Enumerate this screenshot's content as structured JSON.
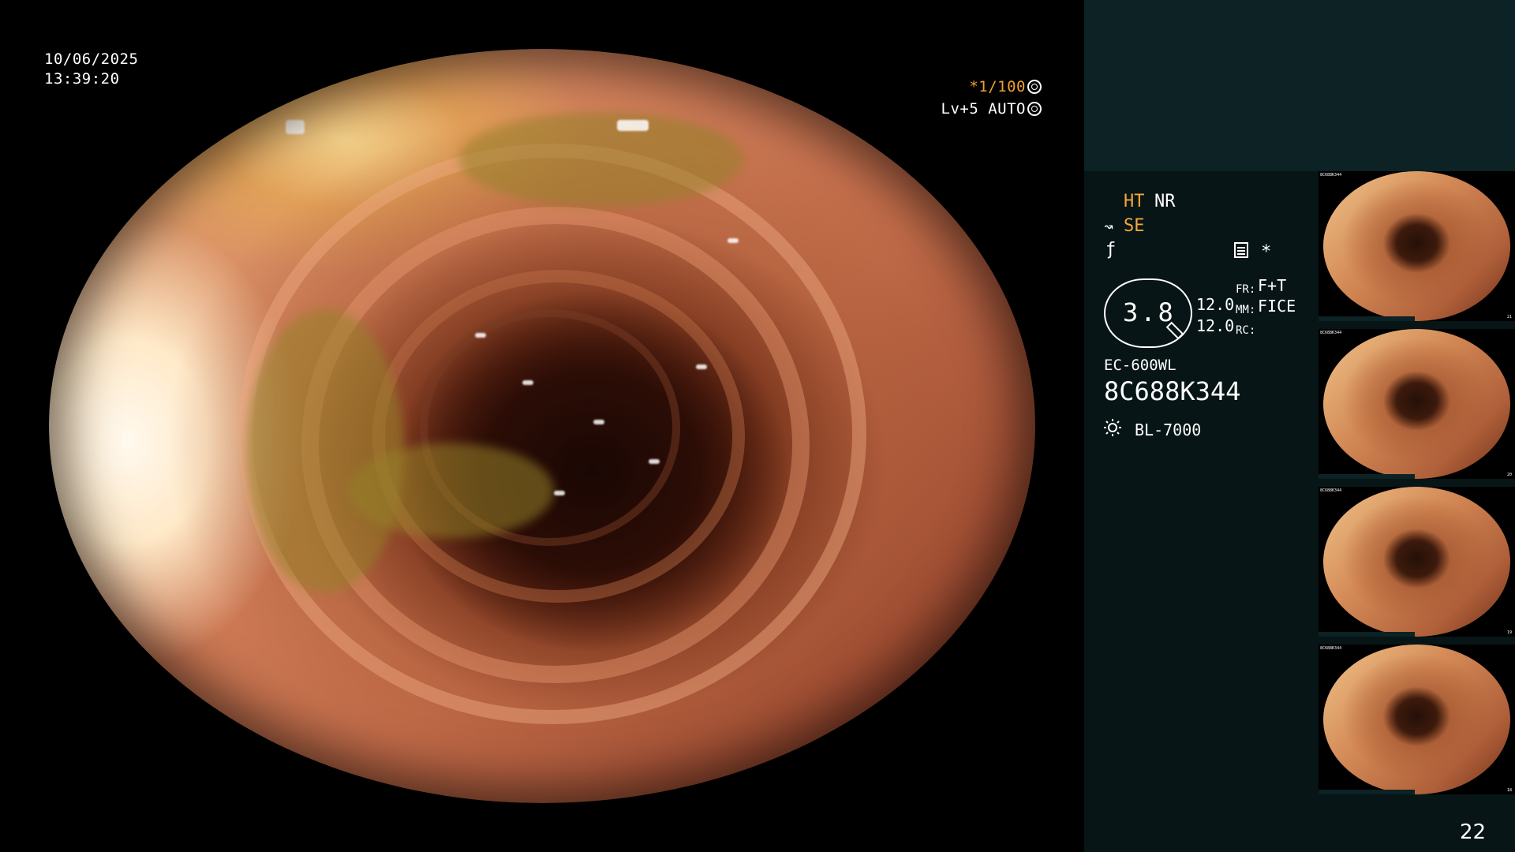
{
  "overlay": {
    "date": "10/06/2025",
    "time": "13:39:20",
    "shutter": "*1/100",
    "level": "Lv+5 AUTO"
  },
  "panel": {
    "ht": "HT",
    "nr": "NR",
    "se": "SE",
    "se_icon": "tilde-arrow-icon",
    "f_icon": "function-icon",
    "star": "*",
    "dial_value": "3.8",
    "value1": "12.0",
    "value2": "12.0",
    "fr_label": "FR:",
    "fr_value": "F+T",
    "mm_label": "MM:",
    "mm_value": "FICE",
    "rc_label": "RC:",
    "scope_model": "EC-600WL",
    "serial": "8C688K344",
    "light_source": "BL-7000"
  },
  "thumbnails": [
    {
      "id": "21",
      "label": "8C688K344"
    },
    {
      "id": "20",
      "label": "8C688K344"
    },
    {
      "id": "19",
      "label": "8C688K344"
    },
    {
      "id": "18",
      "label": "8C688K344"
    }
  ],
  "page_number": "22",
  "colors": {
    "amber": "#f3a63a",
    "panel_bg": "#071517",
    "panel_top_bg": "#0c2224"
  }
}
